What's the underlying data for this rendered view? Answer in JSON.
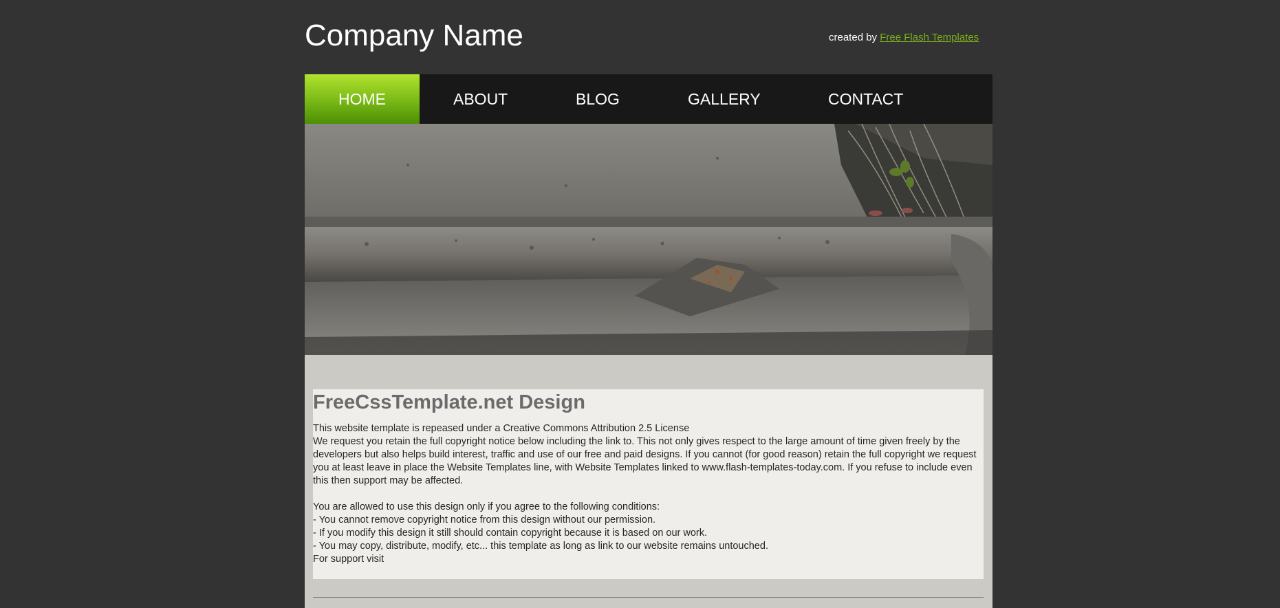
{
  "header": {
    "company_name": "Company Name",
    "credit_prefix": "created by",
    "credit_link": "Free Flash Templates"
  },
  "nav": {
    "items": [
      {
        "label": "HOME",
        "active": true
      },
      {
        "label": "ABOUT",
        "active": false
      },
      {
        "label": "BLOG",
        "active": false
      },
      {
        "label": "GALLERY",
        "active": false
      },
      {
        "label": "CONTACT",
        "active": false
      }
    ]
  },
  "content": {
    "title": "FreeCssTemplate.net Design",
    "license_line": "This website template is repeased under a Creative Commons Attribution 2.5 License",
    "request_lines": [
      "We request you retain the full copyright notice below including the link to. This not only gives respect to the large amount of time given freely by the",
      "developers but also helps build interest, traffic and use of our free and paid designs. If you cannot (for good reason) retain the full copyright we request",
      "you at least leave in place the Website Templates line, with Website Templates linked to www.flash-templates-today.com. If you refuse to include even",
      "this then support may be affected."
    ],
    "conditions_intro": "You are allowed to use this design only if you agree to the following conditions:",
    "conditions": [
      "- You cannot remove copyright notice from this design without our permission.",
      "- If you modify this design it still should contain copyright because it is based on our work.",
      "- You may copy, distribute, modify, etc... this template as long as link to our website remains untouched."
    ],
    "support_line": "For support visit"
  },
  "colors": {
    "page_background": "#333333",
    "nav_background": "#181818",
    "nav_active_top": "#b2e32e",
    "nav_active_bottom": "#4d8f05",
    "credit_link": "#79ad1a",
    "content_background": "#cbcac4",
    "text_box_background": "#efeeea",
    "title_color": "#6b6b6b"
  }
}
